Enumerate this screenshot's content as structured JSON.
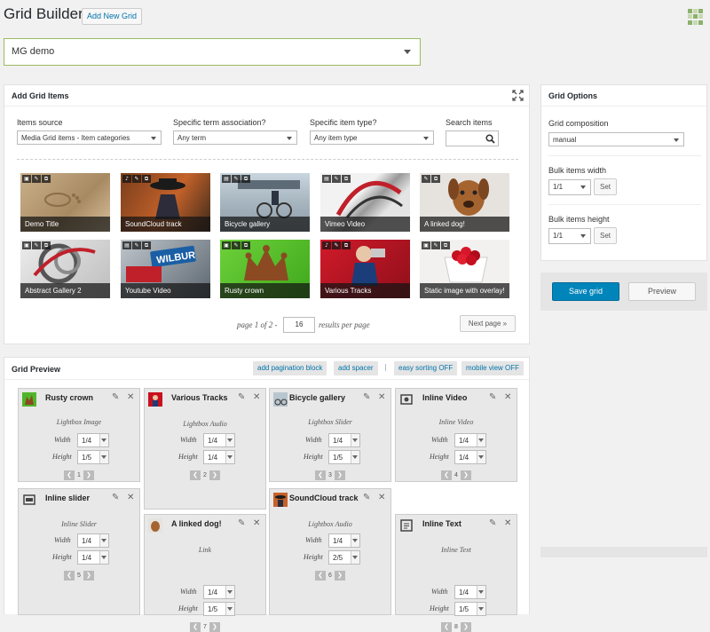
{
  "header": {
    "title": "Grid Builder",
    "add_new_label": "Add New Grid"
  },
  "grid_select": {
    "value": "MG  demo"
  },
  "add_items": {
    "title": "Add Grid Items",
    "items_source_label": "Items source",
    "items_source_value": "Media Grid items - Item categories",
    "term_label": "Specific term association?",
    "term_value": "Any term",
    "type_label": "Specific item type?",
    "type_value": "Any item type",
    "search_label": "Search items",
    "items": [
      {
        "caption": "Demo Title",
        "icons": [
          "▣",
          "✎",
          "⧉"
        ]
      },
      {
        "caption": "SoundCloud track",
        "icons": [
          "♪",
          "✎",
          "⧉"
        ]
      },
      {
        "caption": "Bicycle gallery",
        "icons": [
          "▤",
          "✎",
          "⧉"
        ]
      },
      {
        "caption": "Vimeo Video",
        "icons": [
          "▤",
          "✎",
          "⧉"
        ]
      },
      {
        "caption": "A linked dog!",
        "icons": [
          "✎",
          "⧉"
        ]
      },
      {
        "caption": "Abstract Gallery 2",
        "icons": [
          "▣",
          "✎",
          "⧉"
        ]
      },
      {
        "caption": "Youtube Video",
        "icons": [
          "▤",
          "✎",
          "⧉"
        ]
      },
      {
        "caption": "Rusty crown",
        "icons": [
          "▣",
          "✎",
          "⧉"
        ]
      },
      {
        "caption": "Various Tracks",
        "icons": [
          "♪",
          "✎",
          "⧉"
        ]
      },
      {
        "caption": "Static image with overlay!",
        "icons": [
          "▣",
          "✎",
          "⧉"
        ]
      }
    ],
    "pagination_text": "page 1 of 2 -",
    "per_page_value": "16",
    "per_page_suffix": "results per page",
    "next_label": "Next page »"
  },
  "options": {
    "title": "Grid Options",
    "composition_label": "Grid composition",
    "composition_value": "manual",
    "bulk_width_label": "Bulk items width",
    "bulk_width_value": "1/1",
    "bulk_height_label": "Bulk items height",
    "bulk_height_value": "1/1",
    "set_label": "Set",
    "save_label": "Save grid",
    "preview_label": "Preview"
  },
  "preview": {
    "title": "Grid Preview",
    "buttons": [
      "add pagination block",
      "add spacer",
      "easy sorting OFF",
      "mobile view OFF"
    ],
    "separator": "|",
    "width_label": "Width",
    "height_label": "Height",
    "cards": [
      {
        "title": "Rusty crown",
        "type": "Lightbox Image",
        "width": "1/4",
        "height": "1/5",
        "order": "1",
        "icon": "thumb-rusty"
      },
      {
        "title": "Various Tracks",
        "type": "Lightbox Audio",
        "width": "1/4",
        "height": "1/4",
        "order": "2",
        "icon": "thumb-tracks"
      },
      {
        "title": "Bicycle gallery",
        "type": "Lightbox Slider",
        "width": "1/4",
        "height": "1/5",
        "order": "3",
        "icon": "thumb-bicycle"
      },
      {
        "title": "Inline Video",
        "type": "Inline Video",
        "width": "1/4",
        "height": "1/4",
        "order": "4",
        "icon": "video-icon"
      },
      {
        "title": "Inline slider",
        "type": "Inline Slider",
        "width": "1/4",
        "height": "1/4",
        "order": "5",
        "icon": "slider-icon"
      },
      {
        "title": "A linked dog!",
        "type": "Link",
        "width": "1/4",
        "height": "1/5",
        "order": "7",
        "icon": "thumb-dog"
      },
      {
        "title": "SoundCloud track",
        "type": "Lightbox Audio",
        "width": "1/4",
        "height": "2/5",
        "order": "6",
        "icon": "thumb-soundcloud"
      },
      {
        "title": "Inline Text",
        "type": "Inline Text",
        "width": "1/4",
        "height": "1/5",
        "order": "8",
        "icon": "text-icon"
      }
    ]
  }
}
